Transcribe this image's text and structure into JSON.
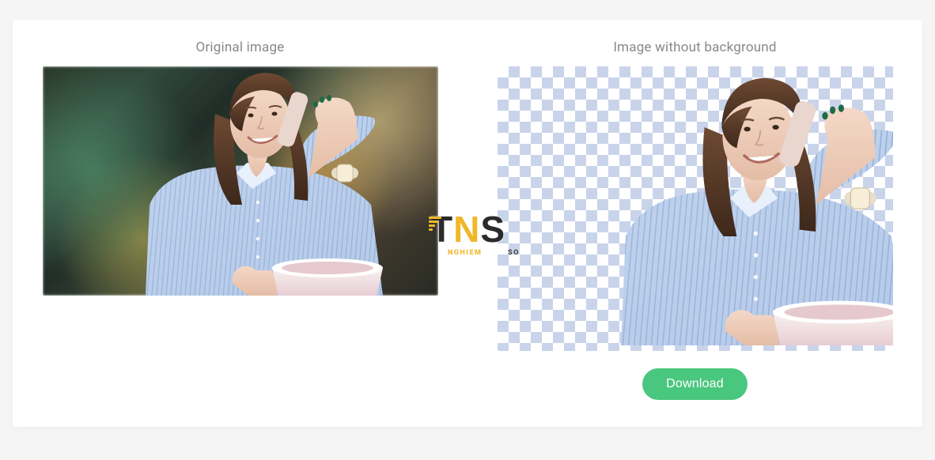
{
  "labels": {
    "original": "Original image",
    "result": "Image without background",
    "download": "Download"
  },
  "watermark": {
    "brand": "TNS",
    "sub_left": "NGHIEM",
    "sub_right": "SO"
  },
  "colors": {
    "accent": "#4ac77f",
    "watermark_yellow": "#f0b829"
  }
}
